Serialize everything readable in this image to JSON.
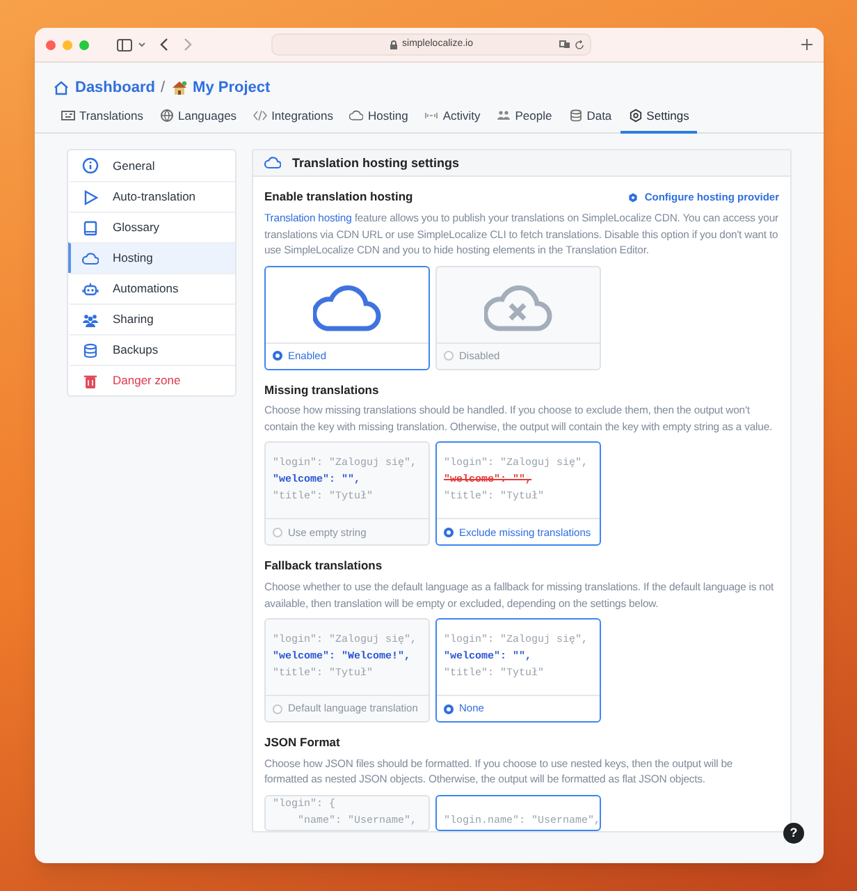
{
  "browser": {
    "url": "simplelocalize.io"
  },
  "breadcrumb": [
    {
      "label": "Dashboard",
      "kind": "home"
    },
    {
      "label": "My Project",
      "kind": "project",
      "separator": "/"
    }
  ],
  "tabs": [
    {
      "label": "Translations",
      "kind": "translations",
      "selected": false
    },
    {
      "label": "Languages",
      "kind": "languages",
      "selected": false
    },
    {
      "label": "Integrations",
      "kind": "integrations",
      "selected": false
    },
    {
      "label": "Hosting",
      "kind": "hosting",
      "selected": false
    },
    {
      "label": "Activity",
      "kind": "activity",
      "selected": false
    },
    {
      "label": "People",
      "kind": "people",
      "selected": false
    },
    {
      "label": "Data",
      "kind": "data",
      "selected": false
    },
    {
      "label": "Settings",
      "kind": "settings",
      "selected": true
    }
  ],
  "sidebar": {
    "items": [
      {
        "label": "General",
        "kind": "info",
        "danger": false,
        "selected": false
      },
      {
        "label": "Auto-translation",
        "kind": "play",
        "danger": false,
        "selected": false
      },
      {
        "label": "Glossary",
        "kind": "book",
        "danger": false,
        "selected": false
      },
      {
        "label": "Hosting",
        "kind": "cloud",
        "danger": false,
        "selected": true
      },
      {
        "label": "Automations",
        "kind": "robot",
        "danger": false,
        "selected": false
      },
      {
        "label": "Sharing",
        "kind": "users",
        "danger": false,
        "selected": false
      },
      {
        "label": "Backups",
        "kind": "database",
        "danger": false,
        "selected": false
      },
      {
        "label": "Danger zone",
        "kind": "trash",
        "danger": true,
        "selected": false
      }
    ]
  },
  "panel": {
    "title": "Translation hosting settings",
    "sections": [
      {
        "title": "Enable translation hosting",
        "action": "Configure hosting provider",
        "description_link": "Translation hosting",
        "description": "feature allows you to publish your translations on SimpleLocalize CDN. You can access your translations via CDN URL or use SimpleLocalize CLI to fetch translations. Disable this option if you don't want to use SimpleLocalize CDN and you to hide hosting elements in the Translation Editor.",
        "options": [
          {
            "kind": "cloud",
            "label": "Enabled",
            "selected": true
          },
          {
            "kind": "cloud-x",
            "label": "Disabled",
            "selected": false
          }
        ]
      },
      {
        "title": "Missing translations",
        "description": "Choose how missing translations should be handled. If you choose to exclude them, then the output won't contain the key with missing translation. Otherwise, the output will contain the key with empty string as a value.",
        "options": [
          {
            "kind": "code",
            "label": "Use empty string",
            "selected": false,
            "lines": [
              {
                "text": "\"login\": \"Zaloguj się\",",
                "kind": "plain"
              },
              {
                "text": "\"welcome\": \"\",",
                "kind": "key"
              },
              {
                "text": "\"title\": \"Tytuł\"",
                "kind": "plain"
              }
            ]
          },
          {
            "kind": "code",
            "label": "Exclude missing translations",
            "selected": true,
            "lines": [
              {
                "text": "\"login\": \"Zaloguj się\",",
                "kind": "plain"
              },
              {
                "text": "\"welcome\": \"\",",
                "kind": "struck"
              },
              {
                "text": "\"title\": \"Tytuł\"",
                "kind": "plain"
              }
            ]
          }
        ]
      },
      {
        "title": "Fallback translations",
        "description": "Choose whether to use the default language as a fallback for missing translations. If the default language is not available, then translation will be empty or excluded, depending on the settings below.",
        "options": [
          {
            "kind": "code",
            "label": "Default language translation",
            "selected": false,
            "lines": [
              {
                "text": "\"login\": \"Zaloguj się\",",
                "kind": "plain"
              },
              {
                "text": "\"welcome\": \"Welcome!\",",
                "kind": "key"
              },
              {
                "text": "\"title\": \"Tytuł\"",
                "kind": "plain"
              }
            ]
          },
          {
            "kind": "code",
            "label": "None",
            "selected": true,
            "lines": [
              {
                "text": "\"login\": \"Zaloguj się\",",
                "kind": "plain"
              },
              {
                "text": "\"welcome\": \"\",",
                "kind": "key"
              },
              {
                "text": "\"title\": \"Tytuł\"",
                "kind": "plain"
              }
            ]
          }
        ]
      },
      {
        "title": "JSON Format",
        "description": "Choose how JSON files should be formatted. If you choose to use nested keys, then the output will be formatted as nested JSON objects. Otherwise, the output will be formatted as flat JSON objects.",
        "options": [
          {
            "kind": "code",
            "selected": false,
            "lines": [
              {
                "text": "\"login\": {",
                "kind": "plain"
              },
              {
                "text": "    \"name\": \"Username\",",
                "kind": "plain"
              }
            ]
          },
          {
            "kind": "code",
            "selected": true,
            "lines": [
              {
                "text": "\"login.name\": \"Username\",",
                "kind": "plain"
              }
            ]
          }
        ]
      }
    ]
  },
  "help": {
    "label": "?"
  }
}
